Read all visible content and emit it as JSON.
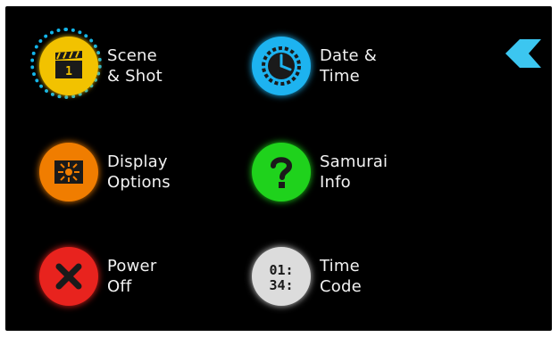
{
  "colors": {
    "screen_background": "#000000",
    "scene_shot": "#f2c200",
    "date_time": "#1db3f0",
    "display_options": "#f07d00",
    "samurai_info": "#1fd21c",
    "power_off": "#e8231e",
    "time_code": "#dcdcdc",
    "selection": "#13b5ea",
    "back": "#3cc6f0"
  },
  "back_button": {
    "icon": "chevron-left-icon"
  },
  "menu": {
    "scene_shot": {
      "line1": "Scene",
      "line2": "& Shot",
      "icon": "clapperboard-icon",
      "clapper_number": "1",
      "selected": true
    },
    "date_time": {
      "line1": "Date &",
      "line2": "Time",
      "icon": "clock-icon"
    },
    "display_options": {
      "line1": "Display",
      "line2": "Options",
      "icon": "brightness-icon"
    },
    "samurai_info": {
      "line1": "Samurai",
      "line2": "Info",
      "icon": "question-icon"
    },
    "power_off": {
      "line1": "Power",
      "line2": "Off",
      "icon": "close-icon"
    },
    "time_code": {
      "line1": "Time",
      "line2": "Code",
      "icon": "timecode-icon",
      "tc_line1": "01:",
      "tc_line2": "34:"
    }
  }
}
